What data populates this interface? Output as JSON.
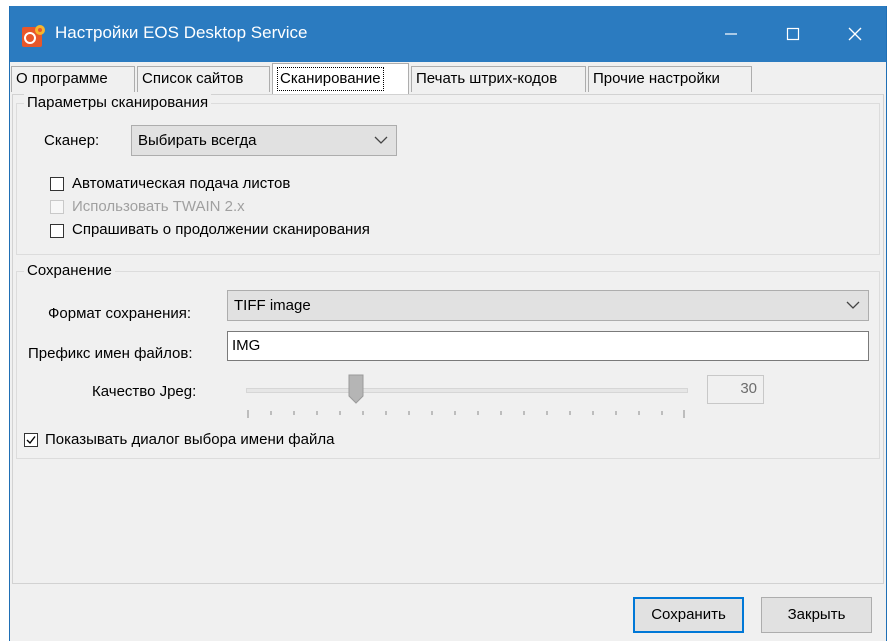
{
  "window": {
    "title": "Настройки EOS Desktop Service",
    "controls": {
      "minimize": "—",
      "maximize": "☐",
      "close": "✕"
    }
  },
  "tabs": [
    {
      "label": "О программе",
      "active": false
    },
    {
      "label": "Список сайтов",
      "active": false
    },
    {
      "label": "Сканирование",
      "active": true
    },
    {
      "label": "Печать штрих-кодов",
      "active": false
    },
    {
      "label": "Прочие настройки",
      "active": false
    }
  ],
  "scan_group": {
    "title": "Параметры сканирования",
    "scanner_label": "Сканер:",
    "scanner_value": "Выбирать всегда",
    "checkboxes": [
      {
        "label": "Автоматическая подача листов",
        "checked": false,
        "enabled": true
      },
      {
        "label": "Использовать TWAIN 2.x",
        "checked": false,
        "enabled": false
      },
      {
        "label": "Спрашивать о продолжении сканирования",
        "checked": false,
        "enabled": true
      }
    ]
  },
  "save_group": {
    "title": "Сохранение",
    "format_label": "Формат сохранения:",
    "format_value": "TIFF image",
    "prefix_label": "Префикс имен файлов:",
    "prefix_value": "IMG",
    "quality_label": "Качество Jpeg:",
    "quality_value": "30",
    "quality_level_fraction": 0.25,
    "show_dialog_label": "Показывать диалог выбора имени файла",
    "show_dialog_checked": true
  },
  "buttons": {
    "save": "Сохранить",
    "close": "Закрыть"
  },
  "colors": {
    "titlebar": "#2b7bc0",
    "accent": "#0078d7",
    "app_icon_bg": "#e8572a",
    "app_icon_fg": "#f7b52c"
  }
}
